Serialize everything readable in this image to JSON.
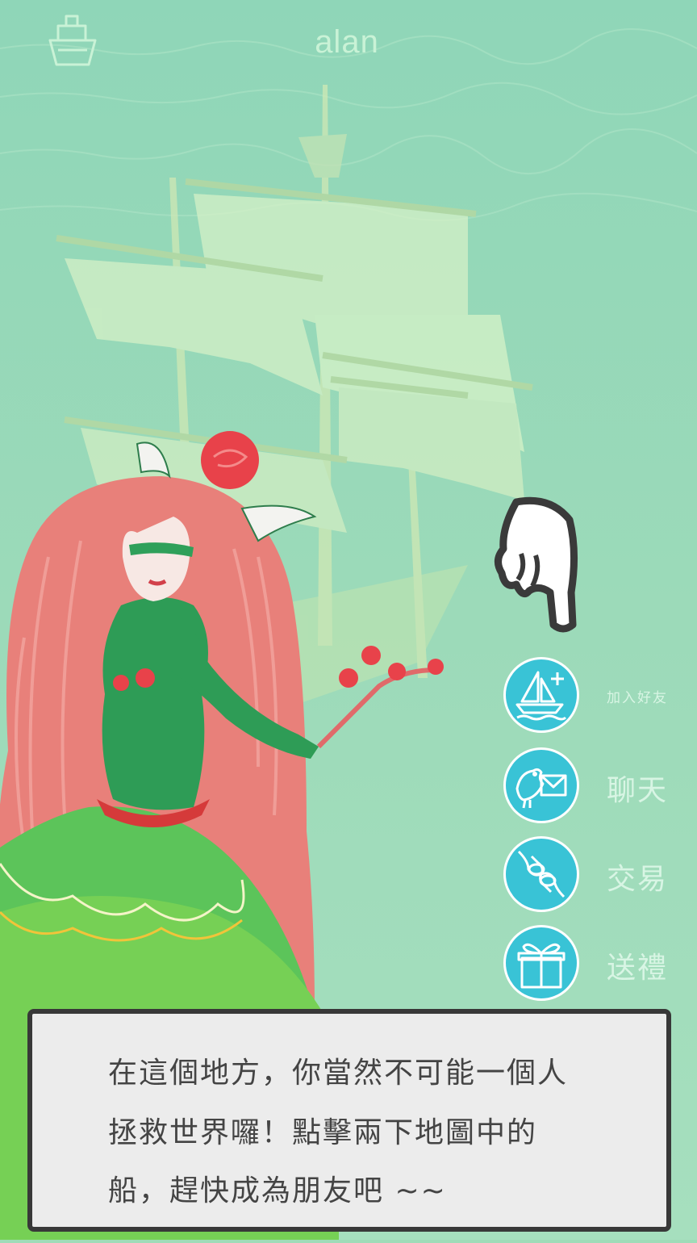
{
  "header": {
    "username": "alan",
    "ship_icon": "ship-icon"
  },
  "actions": [
    {
      "label": "加入好友",
      "icon": "sailboat-plus-icon"
    },
    {
      "label": "聊天",
      "icon": "pigeon-letter-icon"
    },
    {
      "label": "交易",
      "icon": "trade-hands-icon"
    },
    {
      "label": "送禮",
      "icon": "gift-icon"
    }
  ],
  "dialog": {
    "lines": [
      "在這個地方，你當然不可能一個人",
      "拯救世界囉！點擊兩下地圖中的",
      "船，趕快成為朋友吧 ~~"
    ]
  },
  "colors": {
    "sea": "#9fdcb8",
    "action_circle": "#39c3d6",
    "dialog_bg": "#ececec",
    "dialog_border": "#383838"
  }
}
